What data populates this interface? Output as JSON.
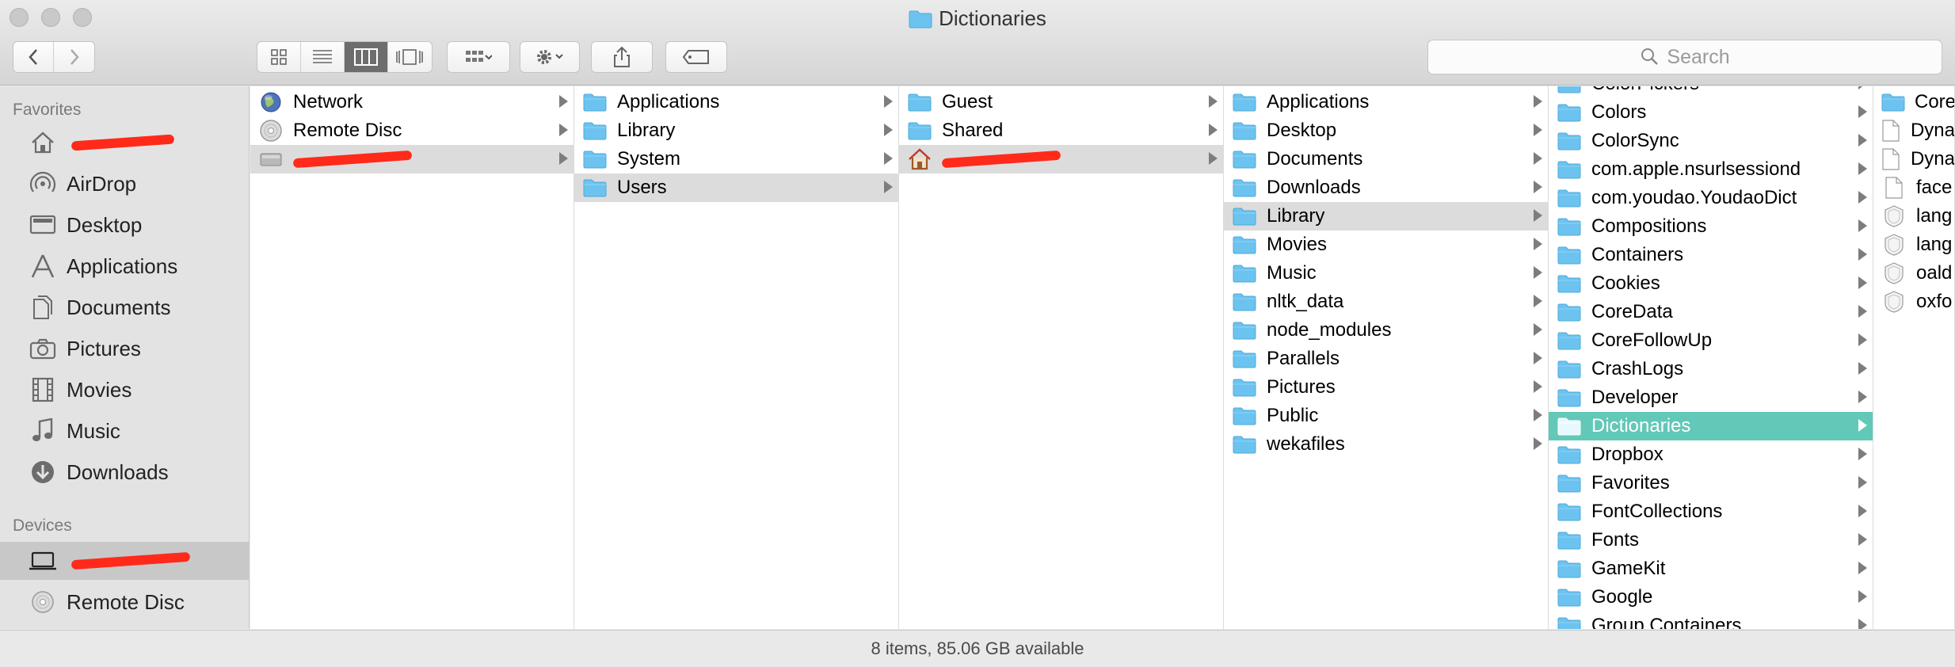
{
  "window": {
    "title": "Dictionaries"
  },
  "toolbar": {
    "search_placeholder": "Search"
  },
  "sidebar": {
    "favorites_header": "Favorites",
    "favorites": [
      {
        "label": "",
        "icon": "home-icon",
        "redacted": true
      },
      {
        "label": "AirDrop",
        "icon": "airdrop-icon"
      },
      {
        "label": "Desktop",
        "icon": "desktop-icon"
      },
      {
        "label": "Applications",
        "icon": "applications-icon"
      },
      {
        "label": "Documents",
        "icon": "documents-icon"
      },
      {
        "label": "Pictures",
        "icon": "camera-icon"
      },
      {
        "label": "Movies",
        "icon": "film-icon"
      },
      {
        "label": "Music",
        "icon": "music-note-icon"
      },
      {
        "label": "Downloads",
        "icon": "download-icon"
      }
    ],
    "devices_header": "Devices",
    "devices": [
      {
        "label": "",
        "icon": "laptop-icon",
        "redacted": true,
        "selected": true
      },
      {
        "label": "Remote Disc",
        "icon": "disc-icon"
      }
    ]
  },
  "columns": [
    {
      "items": [
        {
          "label": "Network",
          "icon": "globe-icon",
          "arrow": true
        },
        {
          "label": "Remote Disc",
          "icon": "disc-icon",
          "arrow": true
        },
        {
          "label": "",
          "icon": "drive-icon",
          "arrow": true,
          "redacted": true,
          "state": "hl"
        }
      ]
    },
    {
      "items": [
        {
          "label": "Applications",
          "icon": "folder-icon",
          "arrow": true
        },
        {
          "label": "Library",
          "icon": "folder-icon",
          "arrow": true
        },
        {
          "label": "System",
          "icon": "folder-icon",
          "arrow": true
        },
        {
          "label": "Users",
          "icon": "folder-icon",
          "arrow": true,
          "state": "hl"
        }
      ]
    },
    {
      "items": [
        {
          "label": "Guest",
          "icon": "folder-icon",
          "arrow": true
        },
        {
          "label": "Shared",
          "icon": "folder-icon",
          "arrow": true
        },
        {
          "label": "",
          "icon": "home-icon",
          "arrow": true,
          "redacted": true,
          "state": "hl"
        }
      ]
    },
    {
      "items": [
        {
          "label": "Applications",
          "icon": "folder-icon",
          "arrow": true
        },
        {
          "label": "Desktop",
          "icon": "folder-icon",
          "arrow": true
        },
        {
          "label": "Documents",
          "icon": "folder-icon",
          "arrow": true
        },
        {
          "label": "Downloads",
          "icon": "folder-icon",
          "arrow": true
        },
        {
          "label": "Library",
          "icon": "folder-icon",
          "arrow": true,
          "state": "hl"
        },
        {
          "label": "Movies",
          "icon": "folder-icon",
          "arrow": true
        },
        {
          "label": "Music",
          "icon": "folder-icon",
          "arrow": true
        },
        {
          "label": "nltk_data",
          "icon": "folder-icon",
          "arrow": true
        },
        {
          "label": "node_modules",
          "icon": "folder-icon",
          "arrow": true
        },
        {
          "label": "Parallels",
          "icon": "folder-icon",
          "arrow": true
        },
        {
          "label": "Pictures",
          "icon": "folder-icon",
          "arrow": true
        },
        {
          "label": "Public",
          "icon": "folder-icon",
          "arrow": true
        },
        {
          "label": "wekafiles",
          "icon": "folder-icon",
          "arrow": true
        }
      ]
    },
    {
      "items": [
        {
          "label": "ColorPickers",
          "icon": "folder-icon",
          "arrow": true
        },
        {
          "label": "Colors",
          "icon": "folder-icon",
          "arrow": true
        },
        {
          "label": "ColorSync",
          "icon": "folder-icon",
          "arrow": true
        },
        {
          "label": "com.apple.nsurlsessiond",
          "icon": "folder-icon",
          "arrow": true
        },
        {
          "label": "com.youdao.YoudaoDict",
          "icon": "folder-icon",
          "arrow": true
        },
        {
          "label": "Compositions",
          "icon": "folder-icon",
          "arrow": true
        },
        {
          "label": "Containers",
          "icon": "folder-icon",
          "arrow": true
        },
        {
          "label": "Cookies",
          "icon": "folder-icon",
          "arrow": true
        },
        {
          "label": "CoreData",
          "icon": "folder-icon",
          "arrow": true
        },
        {
          "label": "CoreFollowUp",
          "icon": "folder-icon",
          "arrow": true
        },
        {
          "label": "CrashLogs",
          "icon": "folder-icon",
          "arrow": true
        },
        {
          "label": "Developer",
          "icon": "folder-icon",
          "arrow": true
        },
        {
          "label": "Dictionaries",
          "icon": "folder-icon",
          "arrow": true,
          "state": "sel"
        },
        {
          "label": "Dropbox",
          "icon": "folder-icon",
          "arrow": true
        },
        {
          "label": "Favorites",
          "icon": "folder-icon",
          "arrow": true
        },
        {
          "label": "FontCollections",
          "icon": "folder-icon",
          "arrow": true
        },
        {
          "label": "Fonts",
          "icon": "folder-icon",
          "arrow": true
        },
        {
          "label": "GameKit",
          "icon": "folder-icon",
          "arrow": true
        },
        {
          "label": "Google",
          "icon": "folder-icon",
          "arrow": true
        },
        {
          "label": "Group Containers",
          "icon": "folder-icon",
          "arrow": true
        }
      ]
    },
    {
      "items": [
        {
          "label": "Core",
          "icon": "folder-icon",
          "arrow": false
        },
        {
          "label": "Dyna",
          "icon": "document-icon",
          "arrow": false
        },
        {
          "label": "Dyna",
          "icon": "document-icon",
          "arrow": false
        },
        {
          "label": "face",
          "icon": "document-icon",
          "arrow": false
        },
        {
          "label": "lang",
          "icon": "bundle-icon",
          "arrow": false
        },
        {
          "label": "lang",
          "icon": "bundle-icon",
          "arrow": false
        },
        {
          "label": "oald",
          "icon": "bundle-icon",
          "arrow": false
        },
        {
          "label": "oxfo",
          "icon": "bundle-icon",
          "arrow": false
        }
      ]
    }
  ],
  "status": {
    "text": "8 items, 85.06 GB available"
  },
  "colors": {
    "selection": "#62c8b8",
    "folder": "#6cc3f0",
    "highlight": "#dcdcdc"
  }
}
